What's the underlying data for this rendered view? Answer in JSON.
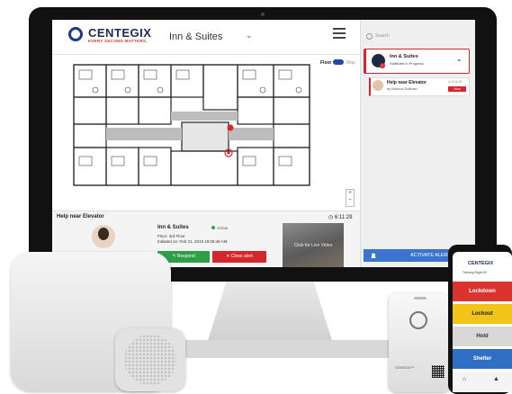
{
  "app": {
    "brand": "CENTEGIX",
    "tagline": "EVERY SECOND MATTERS.",
    "site_selector": "Inn & Suites",
    "site_chevron": "⌄"
  },
  "map": {
    "floor_label": "Floor",
    "map_label": "Map",
    "zoom_in": "+",
    "zoom_out": "−"
  },
  "alert_detail": {
    "title": "Help near Elevator",
    "timer": "◷ 6:11:29",
    "site": "Inn & Suites",
    "status": "Active",
    "floor": "Floor: 3rd Floor",
    "initiated": "Initiated on: Feb 21, 2019 10:06:46 AM",
    "respond_label": "Respond",
    "close_label": "Close alert",
    "video_label": "Click for Live Video"
  },
  "sidebar": {
    "search_placeholder": "Search",
    "card1": {
      "title": "Inn & Suites",
      "subtitle": "StaffAlert in Progress",
      "badge": "1"
    },
    "card2": {
      "title": "Help near Elevator",
      "subtitle": "by Marcus Sullivan",
      "time": "◷ 6:11:29",
      "tag": "New"
    },
    "activate_label": "ACTIVATE ALERT"
  },
  "badge_device": {
    "text": "CENTEGIX™"
  },
  "phone": {
    "brand": "CENTEGIX",
    "sub": "Training Right 65",
    "buttons": [
      {
        "label": "Lockdown",
        "color": "#d9352e",
        "text_color": "#ffffff"
      },
      {
        "label": "Lockout",
        "color": "#f2c318",
        "text_color": "#222222"
      },
      {
        "label": "Hold",
        "color": "#d8d8d8",
        "text_color": "#333333"
      },
      {
        "label": "Shelter",
        "color": "#2f6fc4",
        "text_color": "#ffffff"
      }
    ]
  }
}
